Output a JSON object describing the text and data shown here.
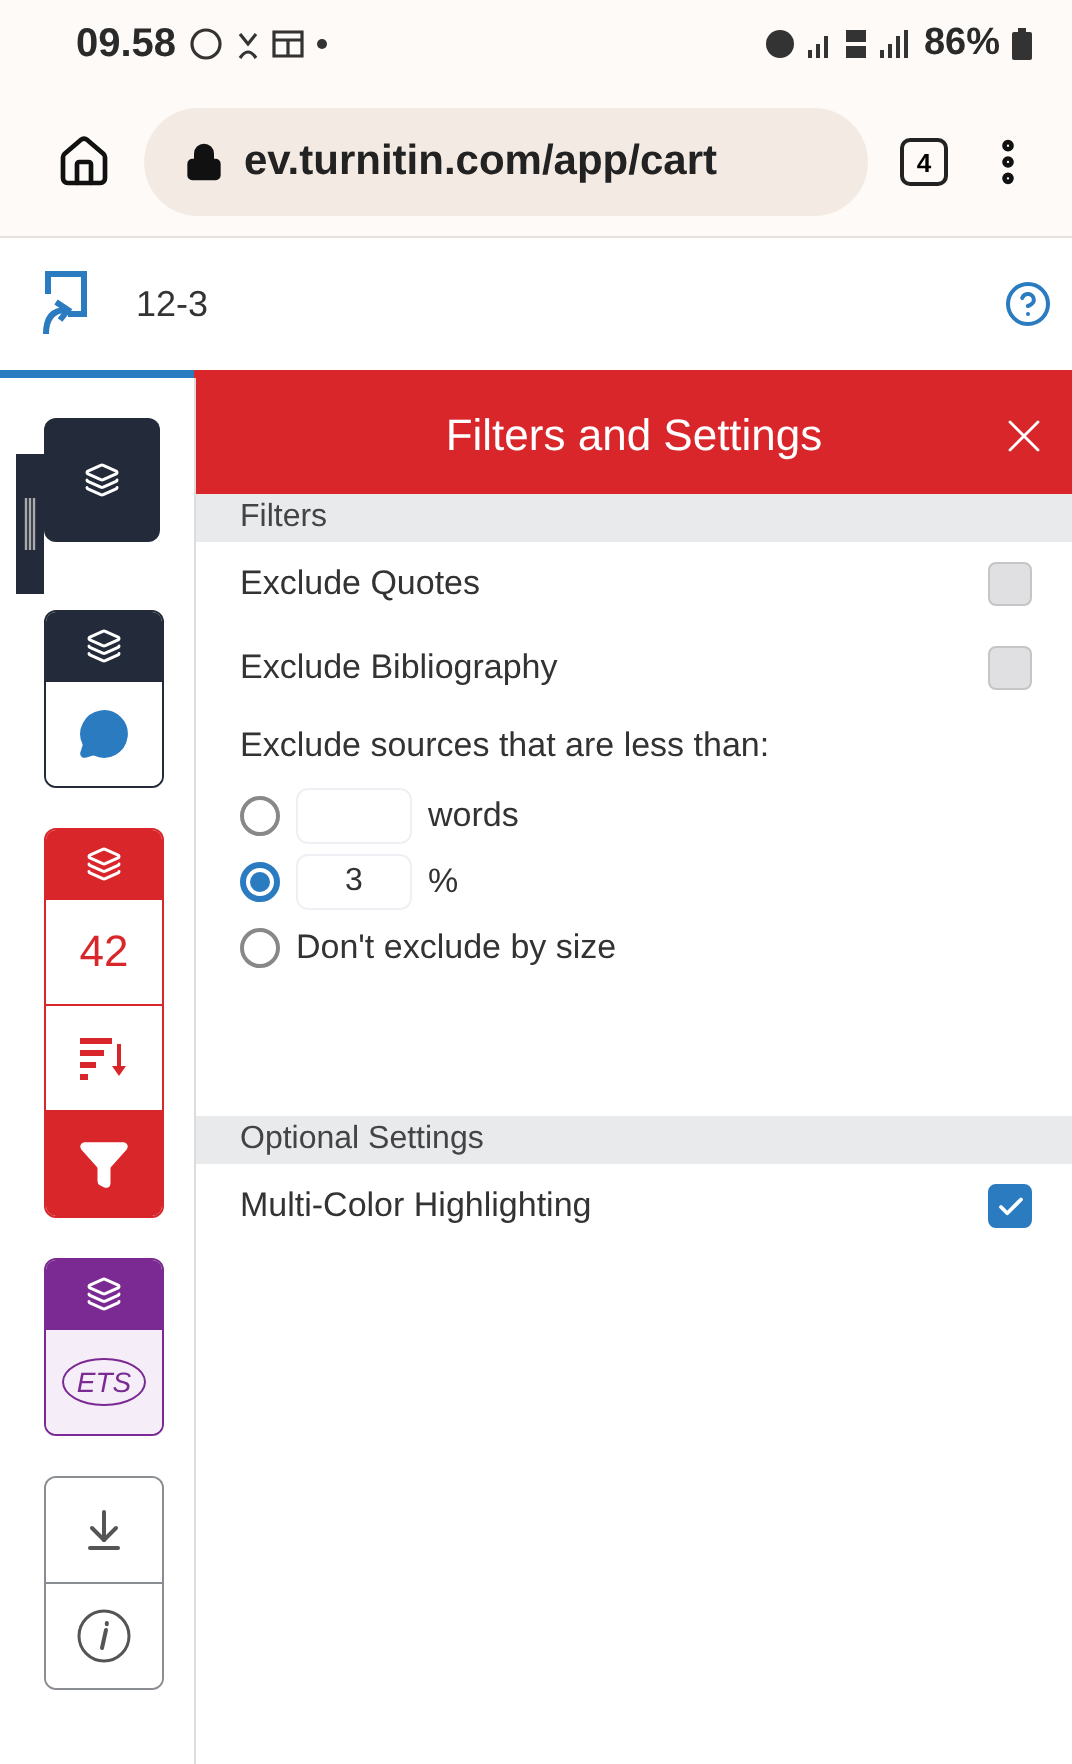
{
  "status_bar": {
    "time": "09.58",
    "battery": "86%"
  },
  "browser": {
    "url": "ev.turnitin.com/app/cart",
    "tab_count": "4"
  },
  "header": {
    "title": "12-3"
  },
  "sidebar": {
    "groups": [
      {
        "kind": "handle",
        "color": "#232a3a"
      },
      {
        "kind": "group",
        "color": "#232a3a",
        "items": [
          {
            "kind": "chat",
            "selected": false
          }
        ]
      },
      {
        "kind": "group",
        "color": "#d9262b",
        "items": [
          {
            "kind": "score",
            "text": "42",
            "selected": false
          },
          {
            "kind": "sort",
            "selected": false
          },
          {
            "kind": "filter",
            "selected": true
          }
        ]
      },
      {
        "kind": "group",
        "color": "#7b2a93",
        "items": [
          {
            "kind": "ets",
            "text": "ETS",
            "selected": false
          }
        ]
      },
      {
        "kind": "plain",
        "color": "#8a8d92",
        "items": [
          {
            "kind": "download",
            "selected": false
          },
          {
            "kind": "info",
            "selected": false
          }
        ]
      }
    ]
  },
  "panel": {
    "title": "Filters and Settings",
    "sections": [
      {
        "heading": "Filters",
        "items": [
          {
            "kind": "checkbox",
            "label": "Exclude Quotes",
            "checked": false
          },
          {
            "kind": "checkbox",
            "label": "Exclude Bibliography",
            "checked": false
          },
          {
            "kind": "text",
            "label": "Exclude sources that are less than:"
          },
          {
            "kind": "radio-input",
            "unit": "words",
            "selected": false
          },
          {
            "kind": "radio-input",
            "value": "3",
            "unit": "%",
            "selected": true
          },
          {
            "kind": "radio",
            "label": "Don't exclude by size",
            "selected": false
          }
        ]
      },
      {
        "heading": "Optional Settings",
        "items": [
          {
            "kind": "checkbox",
            "label": "Multi-Color Highlighting",
            "checked": true
          }
        ]
      }
    ]
  }
}
